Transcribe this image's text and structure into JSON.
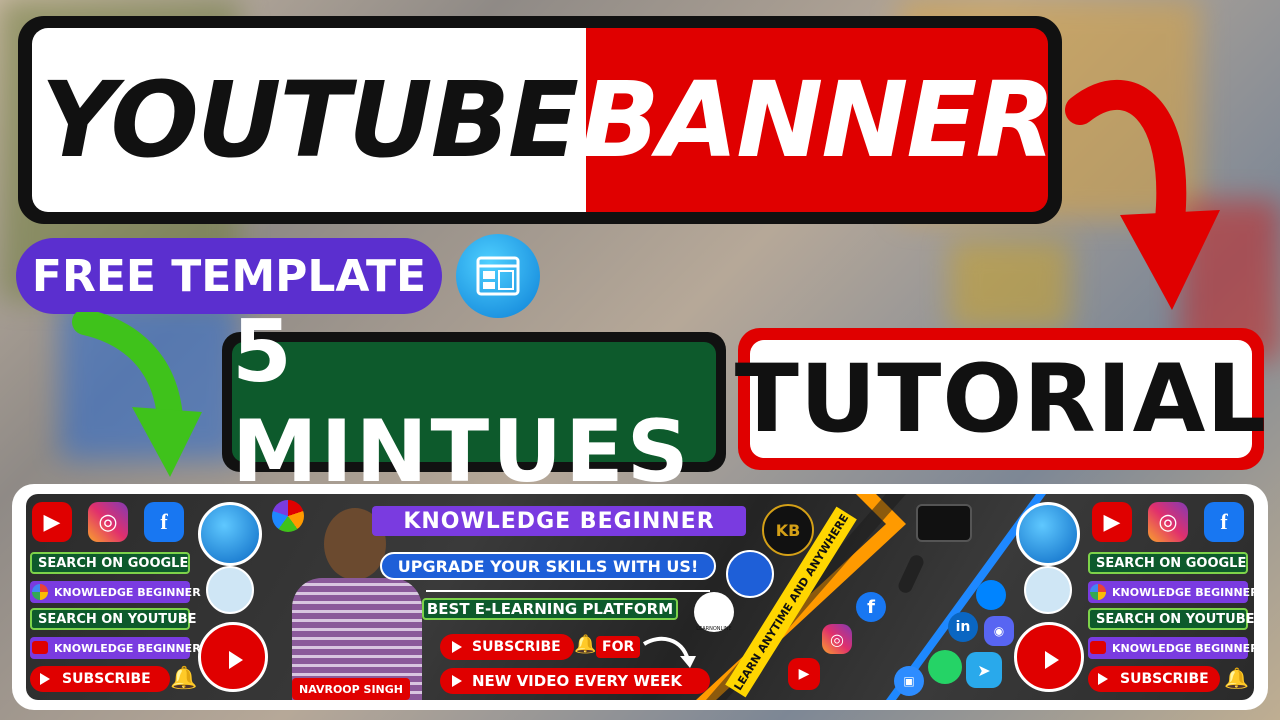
{
  "title": {
    "left": "YOUTUBE",
    "right": "BANNER"
  },
  "badge": {
    "free_template": "FREE TEMPLATE"
  },
  "duration": {
    "text": "5 MINTUES"
  },
  "tutorial": {
    "text": "TUTORIAL"
  },
  "banner": {
    "channel_name": "KNOWLEDGE BEGINNER",
    "tagline": "UPGRADE YOUR SKILLS WITH US!",
    "platform": "BEST E-LEARNING PLATFORM",
    "subscribe": "SUBSCRIBE",
    "for": "FOR",
    "schedule": "NEW VIDEO EVERY WEEK",
    "person": "NAVROOP SINGH",
    "diagonal": "LEARN ANYTIME AND ANYWHERE",
    "logo_kb": "KB",
    "logo_learn": "LEARNONLINE",
    "left": {
      "search_google": "SEARCH ON GOOGLE",
      "search_youtube": "SEARCH ON YOUTUBE",
      "channel1": "KNOWLEDGE BEGINNER",
      "channel2": "KNOWLEDGE BEGINNER",
      "subscribe": "SUBSCRIBE"
    },
    "right": {
      "search_google": "SEARCH ON GOOGLE",
      "search_youtube": "SEARCH ON YOUTUBE",
      "channel1": "KNOWLEDGE BEGINNER",
      "channel2": "KNOWLEDGE BEGINNER",
      "subscribe": "SUBSCRIBE"
    }
  },
  "colors": {
    "red": "#e00000",
    "purple": "#5b2fcf",
    "green_dark": "#0d5a2c",
    "arrow_green": "#3fc21b",
    "accent_blue": "#0a69c4"
  },
  "icons": [
    "youtube-icon",
    "instagram-icon",
    "facebook-icon",
    "globe-icon",
    "bell-icon",
    "google-icon",
    "template-icon",
    "camera-icon",
    "microphone-icon",
    "messenger-icon",
    "linkedin-icon",
    "discord-icon",
    "whatsapp-icon",
    "telegram-icon",
    "zoom-icon",
    "curved-arrow-icon"
  ]
}
